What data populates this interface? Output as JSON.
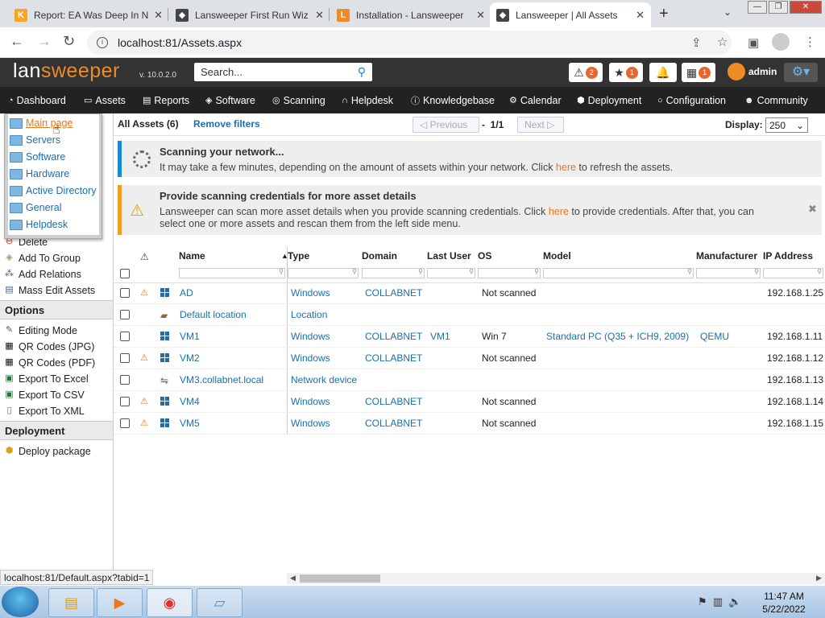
{
  "browser": {
    "tabs": [
      {
        "title": "Report: EA Was Deep In N",
        "favicon": "K",
        "color": "#f5a623"
      },
      {
        "title": "Lansweeper First Run Wiz",
        "favicon": "",
        "color": "#333"
      },
      {
        "title": "Installation - Lansweeper",
        "favicon": "L",
        "color": "#f08a24"
      },
      {
        "title": "Lansweeper | All Assets",
        "favicon": "",
        "color": "#333"
      }
    ],
    "url": "localhost:81/Assets.aspx",
    "window_min": "—",
    "window_max": "❐",
    "window_close": "✕"
  },
  "header": {
    "logo_a": "lan",
    "logo_b": "sweeper",
    "version": "v. 10.0.2.0",
    "search_placeholder": "Search...",
    "alerts_count": "2",
    "favorites_count": "1",
    "calendar_count": "1",
    "user": "admin"
  },
  "mainnav": [
    {
      "label": "Dashboard",
      "icon": "dashboard-icon"
    },
    {
      "label": "Assets",
      "icon": "assets-icon"
    },
    {
      "label": "Reports",
      "icon": "reports-icon"
    },
    {
      "label": "Software",
      "icon": "software-icon"
    },
    {
      "label": "Scanning",
      "icon": "scanning-icon"
    },
    {
      "label": "Helpdesk",
      "icon": "helpdesk-icon"
    },
    {
      "label": "Knowledgebase",
      "icon": "knowledgebase-icon"
    },
    {
      "label": "Calendar",
      "icon": "calendar-icon"
    },
    {
      "label": "Deployment",
      "icon": "deployment-icon"
    },
    {
      "label": "Configuration",
      "icon": "configuration-icon"
    },
    {
      "label": "Community",
      "icon": "community-icon"
    }
  ],
  "dashboard_menu": [
    "Main page",
    "Servers",
    "Software",
    "Hardware",
    "Active Directory",
    "General",
    "Helpdesk"
  ],
  "toolbar": {
    "all_assets": "All Assets (6)",
    "remove_filters": "Remove filters",
    "previous": "Previous",
    "page": "1/1",
    "next": "Next",
    "dash": "-",
    "display_label": "Display:",
    "display_value": "250"
  },
  "banners": {
    "scan_title": "Scanning your network...",
    "scan_text_a": "It may take a few minutes, depending on the amount of assets within your network. Click ",
    "scan_link": "here",
    "scan_text_b": " to refresh the assets.",
    "cred_title": "Provide scanning credentials for more asset details",
    "cred_text_a": "Lansweeper can scan more asset details when you provide scanning credentials. Click ",
    "cred_link": "here",
    "cred_text_b": " to provide credentials. After that, you can",
    "cred_text_c": "select one or more assets and rescan them from the left side menu."
  },
  "sidebar": {
    "actions": [
      "Delete",
      "Add To Group",
      "Add Relations",
      "Mass Edit Assets"
    ],
    "options_header": "Options",
    "options": [
      "Editing Mode",
      "QR Codes (JPG)",
      "QR Codes (PDF)",
      "Export To Excel",
      "Export To CSV",
      "Export To XML"
    ],
    "deployment_header": "Deployment",
    "deployment": [
      "Deploy package"
    ]
  },
  "table": {
    "columns": [
      "Name",
      "Type",
      "Domain",
      "Last User",
      "OS",
      "Model",
      "Manufacturer",
      "IP Address"
    ],
    "rows": [
      {
        "warn": true,
        "icon": "windows",
        "name": "AD",
        "type": "Windows",
        "domain": "COLLABNET",
        "user": "",
        "os": "Not scanned",
        "model": "",
        "manufacturer": "",
        "ip": "192.168.1.25"
      },
      {
        "warn": false,
        "icon": "location",
        "name": "Default location",
        "type": "Location",
        "domain": "",
        "user": "",
        "os": "",
        "model": "",
        "manufacturer": "",
        "ip": ""
      },
      {
        "warn": false,
        "icon": "windows",
        "name": "VM1",
        "type": "Windows",
        "domain": "COLLABNET",
        "user": "VM1",
        "os": "Win 7",
        "model": "Standard PC (Q35 + ICH9, 2009)",
        "manufacturer": "QEMU",
        "ip": "192.168.1.11"
      },
      {
        "warn": true,
        "icon": "windows",
        "name": "VM2",
        "type": "Windows",
        "domain": "COLLABNET",
        "user": "",
        "os": "Not scanned",
        "model": "",
        "manufacturer": "",
        "ip": "192.168.1.12"
      },
      {
        "warn": false,
        "icon": "network",
        "name": "VM3.collabnet.local",
        "type": "Network device",
        "domain": "",
        "user": "",
        "os": "",
        "model": "",
        "manufacturer": "",
        "ip": "192.168.1.13"
      },
      {
        "warn": true,
        "icon": "windows",
        "name": "VM4",
        "type": "Windows",
        "domain": "COLLABNET",
        "user": "",
        "os": "Not scanned",
        "model": "",
        "manufacturer": "",
        "ip": "192.168.1.14"
      },
      {
        "warn": true,
        "icon": "windows",
        "name": "VM5",
        "type": "Windows",
        "domain": "COLLABNET",
        "user": "",
        "os": "Not scanned",
        "model": "",
        "manufacturer": "",
        "ip": "192.168.1.15"
      }
    ]
  },
  "statusbar": "localhost:81/Default.aspx?tabid=1",
  "taskbar": {
    "time": "11:47 AM",
    "date": "5/22/2022"
  }
}
